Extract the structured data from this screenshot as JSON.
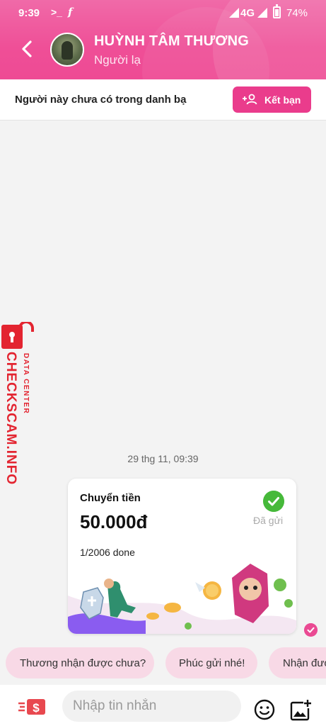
{
  "status_bar": {
    "time": "9:39",
    "icon_a": "terminal-icon",
    "icon_b": "facebook-icon",
    "network": "4G",
    "battery": "74%"
  },
  "header": {
    "back_icon": "chevron-left-icon",
    "contact_name": "HUỲNH TÂM THƯƠNG",
    "contact_status": "Người lạ"
  },
  "banner": {
    "text": "Người này chưa có trong danh bạ",
    "add_friend_label": "Kết bạn",
    "add_friend_icon": "add-person-icon"
  },
  "chat": {
    "date_separator": "29 thg 11, 09:39",
    "transfer_card": {
      "title": "Chuyển tiền",
      "amount": "50.000đ",
      "status": "Đã gửi",
      "note": "1/2006 done",
      "status_icon": "check-circle-icon"
    },
    "delivered_icon": "check-small-icon"
  },
  "quick_replies": [
    "Thương nhận được chưa?",
    "Phúc gửi nhé!",
    "Nhận được"
  ],
  "input_bar": {
    "placeholder": "Nhập tin nhắn",
    "money_icon": "send-money-icon",
    "emoji_icon": "emoji-icon",
    "image_icon": "add-image-icon"
  },
  "watermark": {
    "brand": "CHECKSCAM.INFO",
    "subtitle": "DATA CENTER"
  },
  "colors": {
    "accent": "#ea3c8c",
    "header_bg": "#ef5a9c",
    "chip_bg": "#f8d9e6",
    "success": "#46b93a",
    "watermark": "#e32430"
  }
}
